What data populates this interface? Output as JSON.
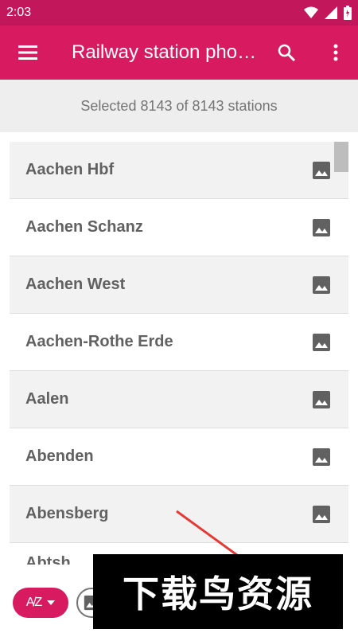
{
  "status_bar": {
    "time": "2:03",
    "icons": [
      "wifi-icon",
      "signal-icon",
      "battery-icon"
    ],
    "color": "#c2185b"
  },
  "app_bar": {
    "title": "Railway station pho…",
    "menu_icon": "menu-icon",
    "search_icon": "search-icon",
    "more_icon": "more-vert-icon",
    "color": "#d81b60"
  },
  "summary": {
    "text": "Selected 8143 of 8143 stations"
  },
  "stations": [
    {
      "name": "Aachen Hbf",
      "icon": "photo-icon"
    },
    {
      "name": "Aachen Schanz",
      "icon": "photo-icon"
    },
    {
      "name": "Aachen West",
      "icon": "photo-icon"
    },
    {
      "name": "Aachen-Rothe Erde",
      "icon": "photo-icon"
    },
    {
      "name": "Aalen",
      "icon": "photo-icon"
    },
    {
      "name": "Abenden",
      "icon": "photo-icon"
    },
    {
      "name": "Abensberg",
      "icon": "photo-icon"
    }
  ],
  "partial_station": "Abtsh...",
  "bottom": {
    "sort_label": "A̸Z",
    "sort_icon": "sort-az-icon",
    "dropdown_icon": "caret-down-icon",
    "filter_icon": "photo-filter-icon"
  },
  "watermark": {
    "text": "下载鸟资源"
  }
}
